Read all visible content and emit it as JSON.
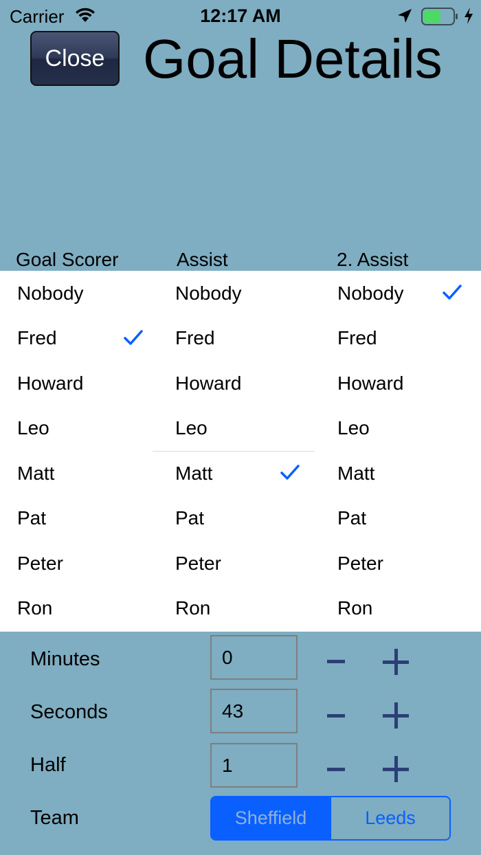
{
  "status_bar": {
    "carrier": "Carrier",
    "time": "12:17 AM",
    "battery_color": "#4cd964"
  },
  "header": {
    "close_label": "Close",
    "title": "Goal Details"
  },
  "picker": {
    "columns": [
      {
        "header": "Goal Scorer",
        "items": [
          "Nobody",
          "Fred",
          "Howard",
          "Leo",
          "Matt",
          "Pat",
          "Peter",
          "Ron"
        ],
        "selected": "Fred"
      },
      {
        "header": "Assist",
        "items": [
          "Nobody",
          "Fred",
          "Howard",
          "Leo",
          "Matt",
          "Pat",
          "Peter",
          "Ron"
        ],
        "selected": "Matt"
      },
      {
        "header": "2. Assist",
        "items": [
          "Nobody",
          "Fred",
          "Howard",
          "Leo",
          "Matt",
          "Pat",
          "Peter",
          "Ron"
        ],
        "selected": "Nobody"
      }
    ],
    "check_color": "#0a60ff"
  },
  "form": {
    "minutes": {
      "label": "Minutes",
      "value": "0"
    },
    "seconds": {
      "label": "Seconds",
      "value": "43"
    },
    "half": {
      "label": "Half",
      "value": "1"
    },
    "team": {
      "label": "Team",
      "options": [
        "Sheffield",
        "Leeds"
      ],
      "selected": "Sheffield"
    }
  },
  "colors": {
    "background": "#7FADC1",
    "accent": "#0a60ff",
    "stepper": "#2c3f74"
  }
}
